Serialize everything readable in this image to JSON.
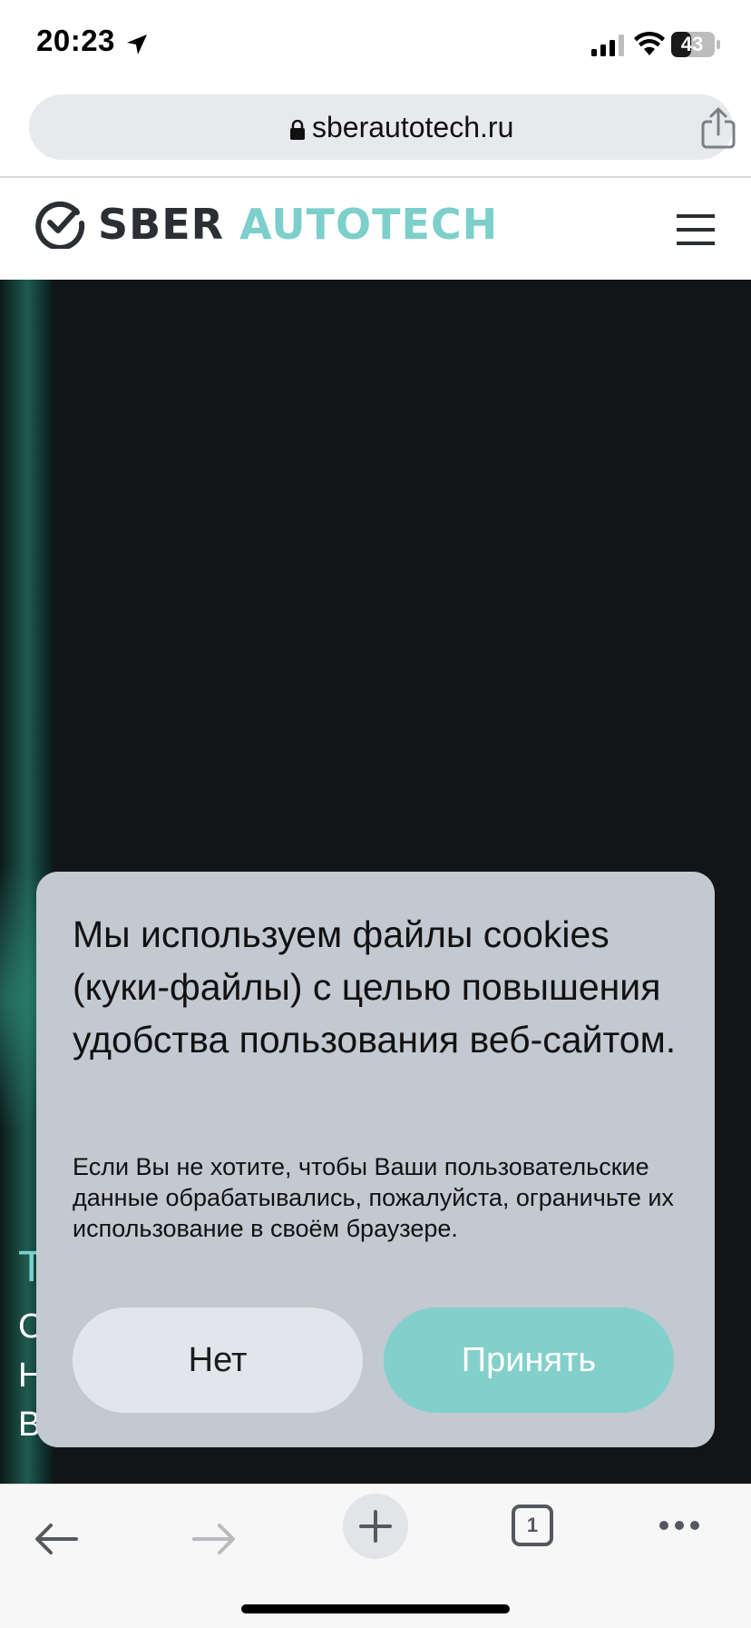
{
  "status_bar": {
    "time": "20:23",
    "battery": "43",
    "icons": [
      "location-arrow-icon",
      "cellular-signal-icon",
      "wifi-icon",
      "battery-icon"
    ]
  },
  "browser": {
    "url": "sberautotech.ru",
    "icons": [
      "lock-icon",
      "share-icon"
    ]
  },
  "site": {
    "logo_sber": "SBER",
    "logo_autotech": "AUTOTECH",
    "logo_icon": "sber-check-logo-icon",
    "menu_icon": "hamburger-menu-icon"
  },
  "hero": {
    "title_fragment": "Т",
    "line_fragments": [
      "С",
      "Н",
      "В"
    ]
  },
  "cookie": {
    "title": "Мы используем файлы cookies (куки-файлы) с целью повышения удобства пользования веб-сайтом.",
    "body": "Если Вы не хотите, чтобы Ваши пользовательские данные обрабатывались, пожалуйста, ограничьте их использование в своём браузере.",
    "decline_label": "Нет",
    "accept_label": "Принять"
  },
  "toolbar": {
    "tab_count": "1",
    "icons": [
      "back-arrow-icon",
      "forward-arrow-icon",
      "new-tab-plus-icon",
      "tabs-icon",
      "more-dots-icon"
    ]
  },
  "colors": {
    "brand_accent": "#7ccfca",
    "accept_button": "#83d0cb",
    "dialog_bg": "#c3c9d1",
    "hero_bg": "#131416"
  }
}
